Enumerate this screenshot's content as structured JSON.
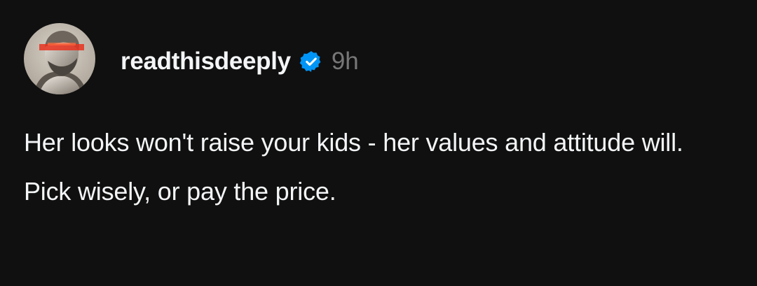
{
  "post": {
    "username": "readthisdeeply",
    "verified_icon": "verified-badge-icon",
    "time": "9h",
    "paragraphs": [
      "Her looks won't raise your kids - her values and attitude will.",
      "Pick wisely, or pay the price."
    ]
  },
  "colors": {
    "background": "#101010",
    "text": "#f3f5f7",
    "muted": "#777777",
    "verified": "#0095f6"
  }
}
